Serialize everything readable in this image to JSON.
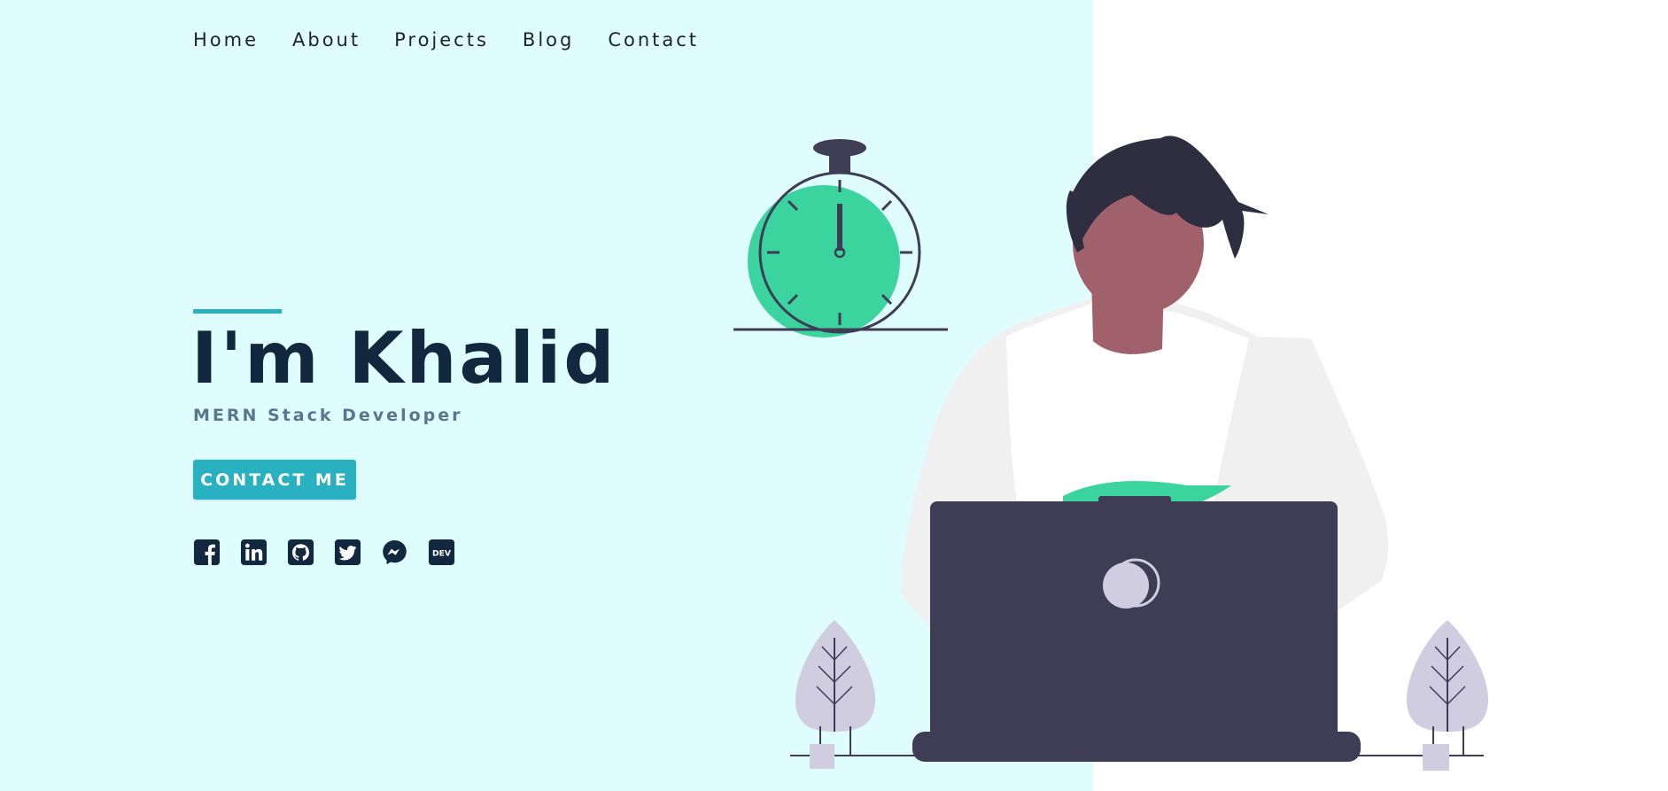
{
  "nav": {
    "items": [
      {
        "label": "Home"
      },
      {
        "label": "About"
      },
      {
        "label": "Projects"
      },
      {
        "label": "Blog"
      },
      {
        "label": "Contact"
      }
    ]
  },
  "hero": {
    "title": "I'm Khalid",
    "subtitle": "MERN Stack Developer",
    "cta_label": "CONTACT ME"
  },
  "socials": [
    {
      "icon": "facebook-icon"
    },
    {
      "icon": "linkedin-icon"
    },
    {
      "icon": "github-icon"
    },
    {
      "icon": "twitter-icon"
    },
    {
      "icon": "messenger-icon"
    },
    {
      "icon": "dev-icon",
      "text": "DEV"
    }
  ],
  "colors": {
    "left_background": "#dffcff",
    "accent": "#2ab1c1",
    "title": "#12283f",
    "subtitle": "#5a7590",
    "laptop": "#3f3d56",
    "green": "#3bd49f",
    "skin": "#a0616a",
    "shirt": "#f0f0f0",
    "plant": "#d0cde1"
  }
}
